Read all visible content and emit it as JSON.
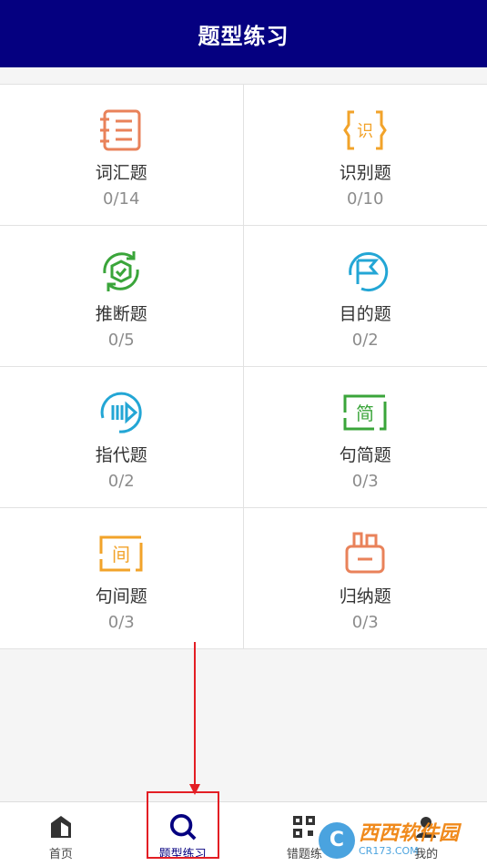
{
  "header": {
    "title": "题型练习"
  },
  "colors": {
    "header_bg": "#050080",
    "accent_red": "#e31e24"
  },
  "categories": [
    {
      "label": "词汇题",
      "count": "0/14",
      "icon": "notebook-icon",
      "color": "#e9825a"
    },
    {
      "label": "识别题",
      "count": "0/10",
      "icon": "recognize-icon",
      "color": "#f2a32a"
    },
    {
      "label": "推断题",
      "count": "0/5",
      "icon": "cube-cycle-icon",
      "color": "#3aa53a"
    },
    {
      "label": "目的题",
      "count": "0/2",
      "icon": "flag-icon",
      "color": "#23a6d5"
    },
    {
      "label": "指代题",
      "count": "0/2",
      "icon": "play-bars-icon",
      "color": "#23a6d5"
    },
    {
      "label": "句简题",
      "count": "0/3",
      "icon": "simplify-icon",
      "color": "#3aa53a"
    },
    {
      "label": "句间题",
      "count": "0/3",
      "icon": "sentence-icon",
      "color": "#f2a32a"
    },
    {
      "label": "归纳题",
      "count": "0/3",
      "icon": "summary-box-icon",
      "color": "#e9825a"
    }
  ],
  "tabs": [
    {
      "label": "首页",
      "icon": "home-icon"
    },
    {
      "label": "题型练习",
      "icon": "search-icon",
      "active": true
    },
    {
      "label": "错题练",
      "icon": "qr-grid-icon"
    },
    {
      "label": "我的",
      "icon": "user-icon"
    }
  ],
  "watermark": {
    "main": "西西软件园",
    "sub": "CR173.COM",
    "logo": "C"
  }
}
